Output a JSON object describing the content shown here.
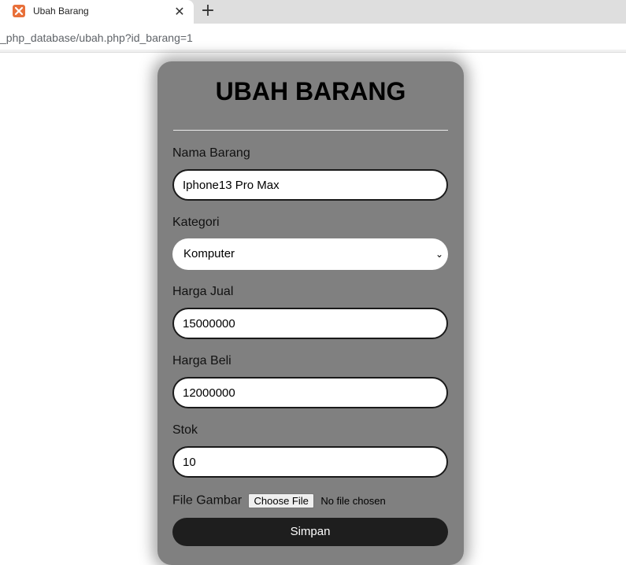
{
  "browser": {
    "tab_title": "Ubah Barang",
    "tab_close": "✕",
    "new_tab": "+",
    "url": "_php_database/ubah.php?id_barang=1",
    "favicon": "xampp-icon"
  },
  "form": {
    "title": "UBAH BARANG",
    "nama_label": "Nama Barang",
    "nama_value": "Iphone13 Pro Max",
    "kategori_label": "Kategori",
    "kategori_value": "Komputer",
    "harga_jual_label": "Harga Jual",
    "harga_jual_value": "15000000",
    "harga_beli_label": "Harga Beli",
    "harga_beli_value": "12000000",
    "stok_label": "Stok",
    "stok_value": "10",
    "file_label": "File Gambar",
    "file_button": "Choose File",
    "file_status": "No file chosen",
    "submit_label": "Simpan"
  },
  "colors": {
    "card": "#808080",
    "button": "#1e1e1e",
    "favicon": "#e8703a"
  }
}
